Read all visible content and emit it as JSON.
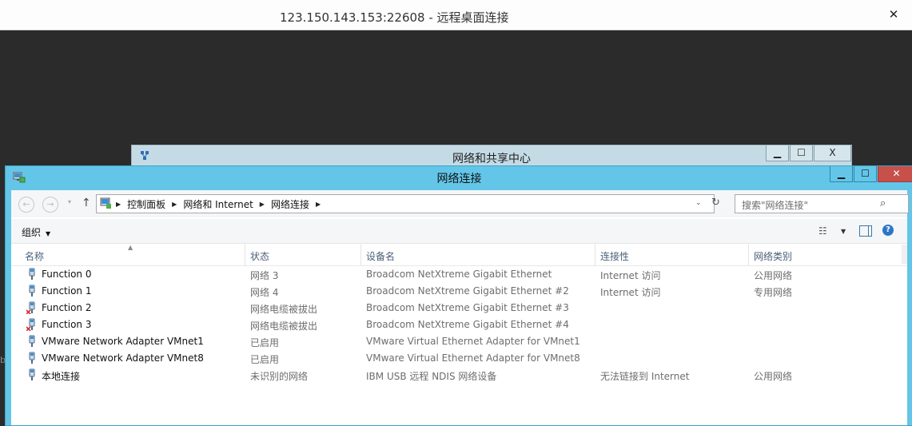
{
  "rdp": {
    "title": "123.150.143.153:22608 - 远程桌面连接",
    "close": "✕",
    "edge_glyph": "b"
  },
  "back_window": {
    "title": "网络和共享中心",
    "minimize": "▁",
    "maximize": "☐",
    "close": "X"
  },
  "window": {
    "title": "网络连接",
    "minimize": "▁",
    "maximize": "☐",
    "close": "✕"
  },
  "nav": {
    "back": "←",
    "forward": "→",
    "recent": "▾",
    "up": "↑"
  },
  "address": {
    "crumbs": [
      "控制面板",
      "网络和 Internet",
      "网络连接"
    ],
    "separator": "▶",
    "dropdown": "⌄",
    "refresh": "↻"
  },
  "search": {
    "placeholder": "搜索\"网络连接\"",
    "icon": "⌕"
  },
  "toolbar": {
    "organize": "组织",
    "organize_caret": "▼",
    "view_icon": "☷",
    "view_caret": "▼",
    "help": "?"
  },
  "columns": [
    "名称",
    "状态",
    "设备名",
    "连接性",
    "网络类别"
  ],
  "sort_indicator": "▲",
  "rows": [
    {
      "name": "Function 0",
      "status": "网络  3",
      "device": "Broadcom NetXtreme Gigabit Ethernet",
      "connectivity": "Internet 访问",
      "category": "公用网络",
      "icon": "network-adapter-icon"
    },
    {
      "name": "Function 1",
      "status": "网络  4",
      "device": "Broadcom NetXtreme Gigabit Ethernet #2",
      "connectivity": "Internet 访问",
      "category": "专用网络",
      "icon": "network-adapter-icon"
    },
    {
      "name": "Function 2",
      "status": "网络电缆被拔出",
      "device": "Broadcom NetXtreme Gigabit Ethernet #3",
      "connectivity": "",
      "category": "",
      "icon": "network-adapter-unplugged-icon"
    },
    {
      "name": "Function 3",
      "status": "网络电缆被拔出",
      "device": "Broadcom NetXtreme Gigabit Ethernet #4",
      "connectivity": "",
      "category": "",
      "icon": "network-adapter-unplugged-icon"
    },
    {
      "name": "VMware Network Adapter VMnet1",
      "status": "已启用",
      "device": "VMware Virtual Ethernet Adapter for VMnet1",
      "connectivity": "",
      "category": "",
      "icon": "network-adapter-icon"
    },
    {
      "name": "VMware Network Adapter VMnet8",
      "status": "已启用",
      "device": "VMware Virtual Ethernet Adapter for VMnet8",
      "connectivity": "",
      "category": "",
      "icon": "network-adapter-icon"
    },
    {
      "name": "本地连接",
      "status": "未识别的网络",
      "device": "IBM USB 远程 NDIS 网络设备",
      "connectivity": "无法链接到 Internet",
      "category": "公用网络",
      "icon": "network-adapter-icon"
    }
  ],
  "colors": {
    "window_frame": "#63c6e8",
    "close_button": "#c7504b",
    "back_frame": "#c4dbe6",
    "desktop": "#2b2b2b"
  }
}
